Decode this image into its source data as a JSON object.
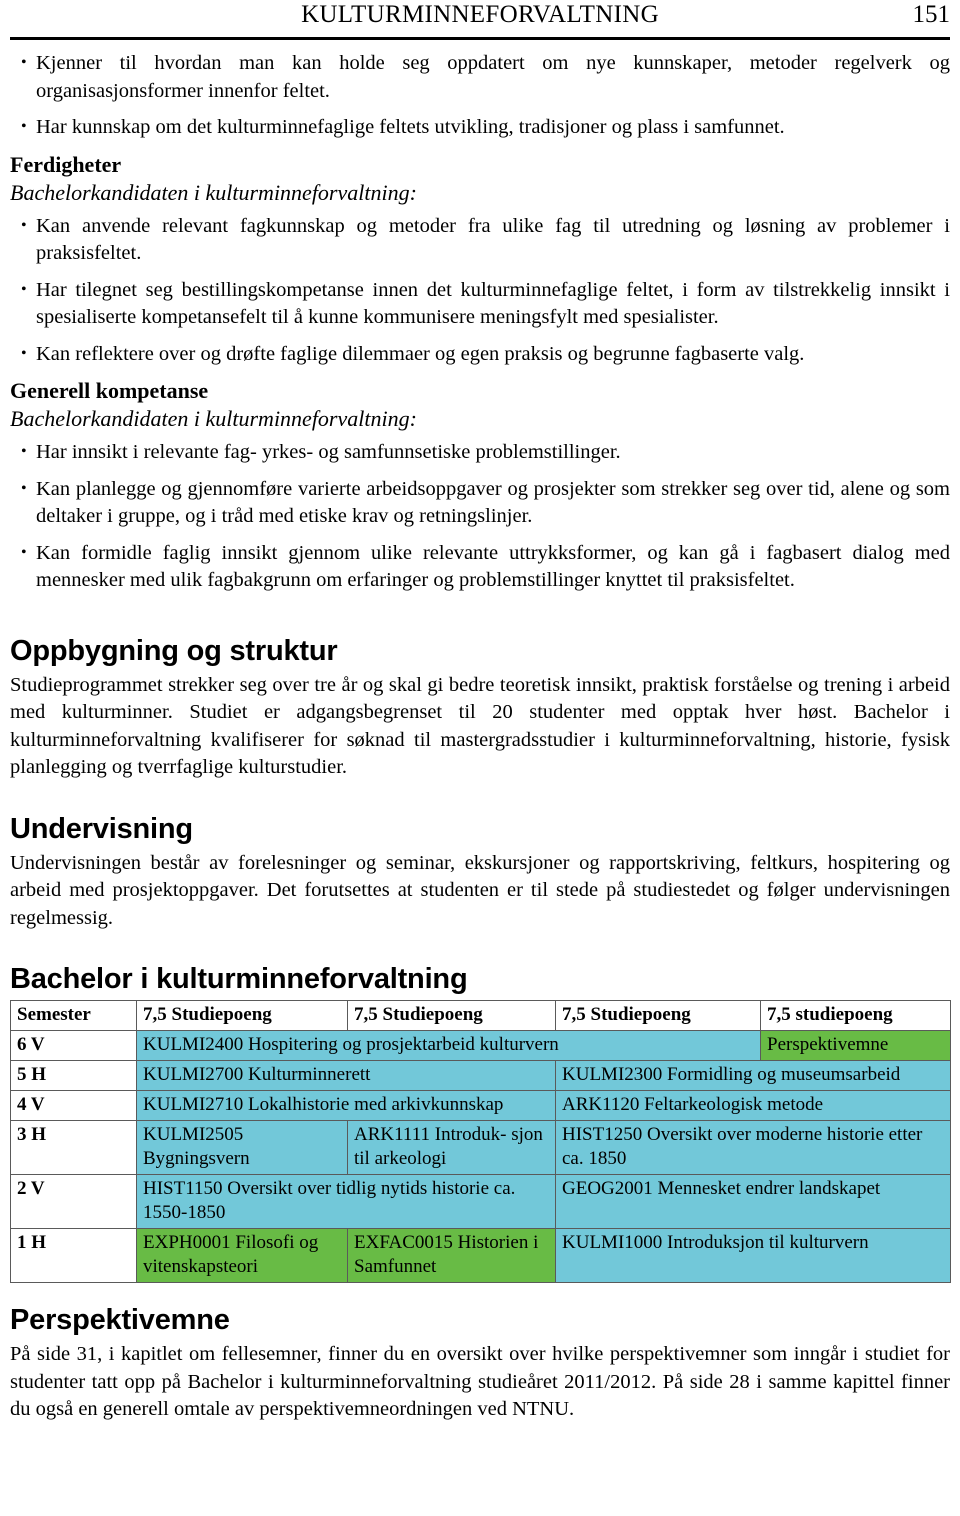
{
  "header": {
    "title": "KULTURMINNEFORVALTNING",
    "page_number": "151"
  },
  "top_bullets": [
    "Kjenner til hvordan man kan holde seg oppdatert om nye kunnskaper, metoder regelverk og organisasjonsformer innenfor feltet.",
    "Har kunnskap om det kulturminnefaglige feltets utvikling, tradisjoner og plass i samfunnet."
  ],
  "ferdigheter": {
    "heading": "Ferdigheter",
    "subheading": "Bachelorkandidaten i kulturminneforvaltning:",
    "bullets": [
      "Kan anvende relevant fagkunnskap og metoder fra ulike fag til utredning og løsning av problemer i praksisfeltet.",
      "Har tilegnet seg bestillingskompetanse innen det kulturminnefaglige feltet, i form av tilstrekkelig innsikt i spesialiserte kompetansefelt til å kunne kommunisere meningsfylt med spesialister.",
      "Kan reflektere over og drøfte faglige dilemmaer og egen praksis og begrunne fagbaserte valg."
    ]
  },
  "generell_kompetanse": {
    "heading": "Generell kompetanse",
    "subheading": "Bachelorkandidaten i kulturminneforvaltning:",
    "bullets": [
      "Har innsikt i relevante fag- yrkes- og samfunnsetiske problemstillinger.",
      "Kan planlegge og gjennomføre varierte arbeidsoppgaver og prosjekter som strekker seg over tid, alene og som deltaker i gruppe, og i tråd med etiske krav og retningslinjer.",
      "Kan formidle faglig innsikt gjennom ulike relevante uttrykksformer, og kan gå i fagbasert dialog med mennesker med ulik fagbakgrunn om erfaringer og problemstillinger knyttet til praksisfeltet."
    ]
  },
  "oppbygning": {
    "heading": "Oppbygning og struktur",
    "paragraph": "Studieprogrammet strekker seg over tre år og skal gi bedre teoretisk innsikt, praktisk forståelse og trening i arbeid med kulturminner. Studiet er adgangsbegrenset til 20 studenter med opptak hver høst. Bachelor i kulturminneforvaltning kvalifiserer for søknad til mastergradsstudier i kulturminneforvaltning, historie, fysisk planlegging og tverrfaglige kulturstudier."
  },
  "undervisning": {
    "heading": "Undervisning",
    "paragraph": "Undervisningen består av forelesninger og seminar, ekskursjoner og rapportskriving, feltkurs, hospitering og arbeid med prosjektoppgaver. Det forutsettes at studenten er til stede på studiestedet og følger undervisningen regelmessig."
  },
  "plan": {
    "heading": "Bachelor i kulturminneforvaltning",
    "colors": {
      "cyan": "#72c8d9",
      "green": "#68bb45",
      "white": "#ffffff",
      "border": "#5a5a5a"
    },
    "columns": [
      "Semester",
      "7,5 Studiepoeng",
      "7,5 Studiepoeng",
      "7,5 Studiepoeng",
      "7,5 studiepoeng"
    ],
    "rows": [
      {
        "semester": "6 V",
        "cells": [
          {
            "text": "KULMI2400 Hospitering og prosjektarbeid kulturvern",
            "color": "cyan",
            "span": 3
          },
          {
            "text": "Perspektivemne",
            "color": "green",
            "span": 1
          }
        ]
      },
      {
        "semester": "5 H",
        "cells": [
          {
            "text": "KULMI2700 Kulturminnerett",
            "color": "cyan",
            "span": 2
          },
          {
            "text": "KULMI2300 Formidling og museumsarbeid",
            "color": "cyan",
            "span": 2
          }
        ]
      },
      {
        "semester": "4 V",
        "cells": [
          {
            "text": "KULMI2710 Lokalhistorie med arkivkunnskap",
            "color": "cyan",
            "span": 2
          },
          {
            "text": "ARK1120 Feltarkeologisk metode",
            "color": "cyan",
            "span": 2
          }
        ]
      },
      {
        "semester": "3 H",
        "cells": [
          {
            "text": "KULMI2505 Bygningsvern",
            "color": "cyan",
            "span": 1
          },
          {
            "text": "ARK1111 Introduk- sjon til arkeologi",
            "color": "cyan",
            "span": 1
          },
          {
            "text": "HIST1250 Oversikt over moderne historie etter ca. 1850",
            "color": "cyan",
            "span": 2
          }
        ]
      },
      {
        "semester": "2 V",
        "cells": [
          {
            "text": "HIST1150 Oversikt over tidlig nytids historie ca. 1550-1850",
            "color": "cyan",
            "span": 2
          },
          {
            "text": "GEOG2001 Mennesket endrer landskapet",
            "color": "cyan",
            "span": 2
          }
        ]
      },
      {
        "semester": "1 H",
        "cells": [
          {
            "text": "EXPH0001 Filosofi og vitenskapsteori",
            "color": "green",
            "span": 1
          },
          {
            "text": "EXFAC0015 Historien i Samfunnet",
            "color": "green",
            "span": 1
          },
          {
            "text": "KULMI1000 Introduksjon til kulturvern",
            "color": "cyan",
            "span": 2
          }
        ]
      }
    ]
  },
  "perspektivemne": {
    "heading": "Perspektivemne",
    "paragraph": "På side 31, i kapitlet om fellesemner, finner du en oversikt over hvilke perspektivemner som inngår i studiet for studenter tatt opp på Bachelor i kulturminneforvaltning studieåret 2011/2012. På side 28 i samme kapittel finner du også en generell omtale av perspektivemneordningen ved NTNU."
  }
}
